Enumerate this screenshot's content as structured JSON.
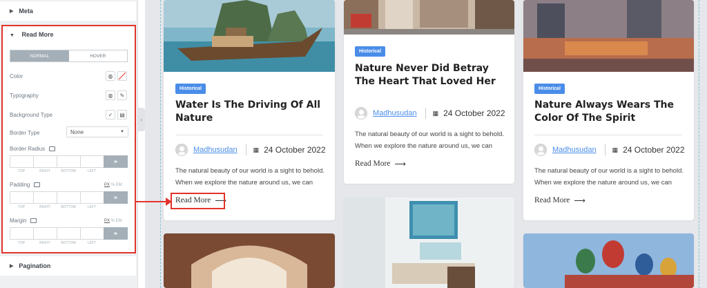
{
  "panel": {
    "meta_label": "Meta",
    "read_more_label": "Read More",
    "tabs": [
      "NORMAL",
      "HOVER"
    ],
    "color_label": "Color",
    "typography_label": "Typography",
    "background_type_label": "Background Type",
    "border_type_label": "Border Type",
    "border_type_value": "None",
    "border_radius_label": "Border Radius",
    "padding_label": "Padding",
    "margin_label": "Margin",
    "dim_labels": [
      "TOP",
      "RIGHT",
      "BOTTOM",
      "LEFT"
    ],
    "units": [
      "PX",
      "%",
      "EM"
    ],
    "pagination_label": "Pagination"
  },
  "posts": [
    {
      "category": "Historical",
      "title_line1": "Water Is The Driving Of All",
      "title_line2": "Nature",
      "author": "Madhusudan",
      "date": "24 October 2022",
      "excerpt_line1": "The natural beauty of our world is a sight to behold.",
      "excerpt_line2": "When we explore the nature around us, we can",
      "read_more": "Read More"
    },
    {
      "category": "Historical",
      "title_line1": "Nature Never Did Betray",
      "title_line2": "The Heart That Loved Her",
      "author": "Madhusudan",
      "date": "24 October 2022",
      "excerpt_line1": "The natural beauty of our world is a sight to behold.",
      "excerpt_line2": "When we explore the nature around us, we can",
      "read_more": "Read More"
    },
    {
      "category": "Historical",
      "title_line1": "Nature Always Wears The",
      "title_line2": "Color Of The Spirit",
      "author": "Madhusudan",
      "date": "24 October 2022",
      "excerpt_line1": "The natural beauty of our world is a sight to behold.",
      "excerpt_line2": "When we explore the nature around us, we can",
      "read_more": "Read More"
    }
  ],
  "colors": {
    "accent": "#4a8de8",
    "highlight": "#e3322b"
  }
}
